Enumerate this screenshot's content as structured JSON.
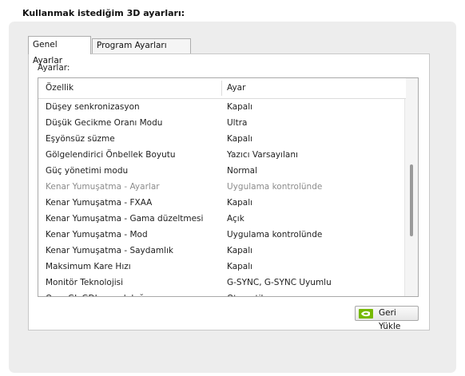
{
  "heading": "Kullanmak istediğim 3D ayarları:",
  "tabs": [
    {
      "label": "Genel Ayarlar"
    },
    {
      "label": "Program Ayarları"
    }
  ],
  "settings_label": "Ayarlar:",
  "columns": {
    "feature": "Özellik",
    "setting": "Ayar"
  },
  "rows": [
    {
      "feature": "Düşey senkronizasyon",
      "setting": "Kapalı"
    },
    {
      "feature": "Düşük Gecikme Oranı Modu",
      "setting": "Ultra"
    },
    {
      "feature": "Eşyönsüz süzme",
      "setting": "Kapalı"
    },
    {
      "feature": "Gölgelendirici Önbellek Boyutu",
      "setting": "Yazıcı Varsayılanı"
    },
    {
      "feature": "Güç yönetimi modu",
      "setting": "Normal"
    },
    {
      "feature": "Kenar Yumuşatma - Ayarlar",
      "setting": "Uygulama kontrolünde"
    },
    {
      "feature": "Kenar Yumuşatma - FXAA",
      "setting": "Kapalı"
    },
    {
      "feature": "Kenar Yumuşatma - Gama düzeltmesi",
      "setting": "Açık"
    },
    {
      "feature": "Kenar Yumuşatma - Mod",
      "setting": "Uygulama kontrolünde"
    },
    {
      "feature": "Kenar Yumuşatma - Saydamlık",
      "setting": "Kapalı"
    },
    {
      "feature": "Maksimum Kare Hızı",
      "setting": "Kapalı"
    },
    {
      "feature": "Monitör Teknolojisi",
      "setting": "G-SYNC, G-SYNC Uyumlu"
    },
    {
      "feature": "OpenGL GDI uyumluluğu",
      "setting": "Otomatik"
    }
  ],
  "reset_button": {
    "label": "Geri Yükle",
    "icon": "nvidia-logo-icon"
  },
  "colors": {
    "nvidia_green": "#76b900",
    "disabled_text": "#8c8c8c"
  }
}
